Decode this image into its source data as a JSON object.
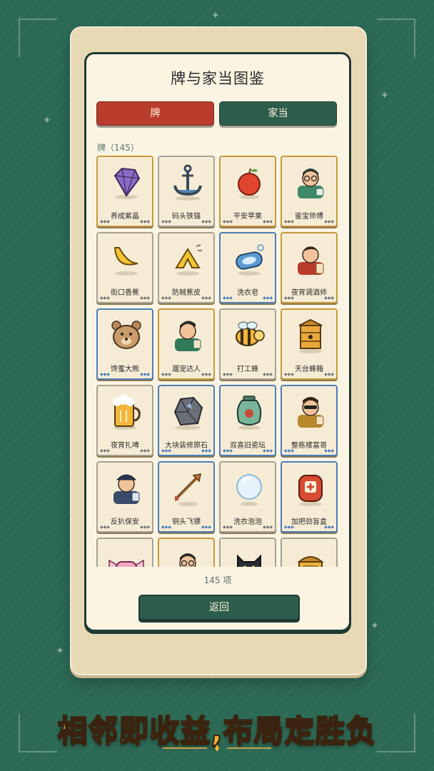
{
  "dialog": {
    "title": "牌与家当图鉴",
    "tabs": [
      {
        "label": "牌",
        "active": true,
        "color": "#b93c2c"
      },
      {
        "label": "家当",
        "active": false,
        "color": "#2d5e4d"
      }
    ],
    "section_label": "牌（145）",
    "count_text": "145 项",
    "back_label": "返回"
  },
  "cards": [
    {
      "name": "养成紫晶",
      "icon": "amethyst-icon",
      "rarity": "gold"
    },
    {
      "name": "码头铁锚",
      "icon": "anchor-icon",
      "rarity": "gray"
    },
    {
      "name": "平安苹果",
      "icon": "apple-icon",
      "rarity": "gold"
    },
    {
      "name": "鉴宝师傅",
      "icon": "appraiser-icon",
      "rarity": "gold"
    },
    {
      "name": "街口香蕉",
      "icon": "banana-icon",
      "rarity": "gray"
    },
    {
      "name": "防贼蕉皮",
      "icon": "banana-peel-icon",
      "rarity": "gray"
    },
    {
      "name": "洗衣皂",
      "icon": "soap-icon",
      "rarity": "blue"
    },
    {
      "name": "夜宵调酒师",
      "icon": "bartender-icon",
      "rarity": "gold"
    },
    {
      "name": "馋蜜大熊",
      "icon": "bear-icon",
      "rarity": "blue"
    },
    {
      "name": "遛宠达人",
      "icon": "pet-walker-icon",
      "rarity": "gold"
    },
    {
      "name": "打工蜂",
      "icon": "bee-icon",
      "rarity": "gray"
    },
    {
      "name": "天台蜂箱",
      "icon": "beehive-icon",
      "rarity": "gold"
    },
    {
      "name": "夜宵扎啤",
      "icon": "beer-icon",
      "rarity": "gray"
    },
    {
      "name": "大块装修原石",
      "icon": "ore-icon",
      "rarity": "blue"
    },
    {
      "name": "双喜旧瓷坛",
      "icon": "jar-icon",
      "rarity": "blue"
    },
    {
      "name": "整栋楼富哥",
      "icon": "rich-guy-icon",
      "rarity": "blue"
    },
    {
      "name": "反扒保安",
      "icon": "security-guard-icon",
      "rarity": "gray"
    },
    {
      "name": "铜头飞镖",
      "icon": "arrow-icon",
      "rarity": "blue"
    },
    {
      "name": "洗衣泡泡",
      "icon": "bubble-icon",
      "rarity": "gray"
    },
    {
      "name": "加把劲盲盒",
      "icon": "blind-box-icon",
      "rarity": "blue"
    },
    {
      "name": "",
      "icon": "candy-icon",
      "rarity": "gray"
    },
    {
      "name": "",
      "icon": "nerd-icon",
      "rarity": "gold"
    },
    {
      "name": "",
      "icon": "black-cat-icon",
      "rarity": "gray"
    },
    {
      "name": "",
      "icon": "treasure-chest-icon",
      "rarity": "gray"
    }
  ],
  "slogan": "相邻即收益,布局定胜负",
  "colors": {
    "background": "#2c6a55",
    "panel": "#fbf4e3",
    "gold": "#c89a3e",
    "blue": "#4d7fb8",
    "slogan": "#f3b538"
  }
}
